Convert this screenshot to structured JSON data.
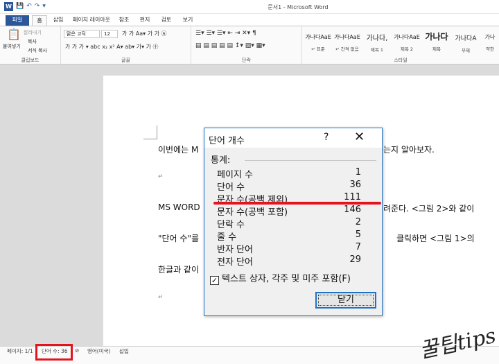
{
  "window": {
    "title": "문서1 - Microsoft Word"
  },
  "tabs": [
    "파일",
    "홈",
    "삽입",
    "페이지 레이아웃",
    "참조",
    "편지",
    "검토",
    "보기"
  ],
  "ribbon": {
    "clipboard": {
      "paste": "붙여넣기",
      "cut": "잘라내기",
      "copy": "복사",
      "format_painter": "서식 복사",
      "label": "클립보드"
    },
    "font": {
      "name": "맑은 고딕",
      "size": "12",
      "label": "글꼴"
    },
    "paragraph": {
      "label": "단락"
    },
    "styles": {
      "label": "스타일",
      "items": [
        {
          "sample": "가나다AaE",
          "name": "↵ 표준"
        },
        {
          "sample": "가나다AaE",
          "name": "↵ 간격 없음"
        },
        {
          "sample": "가나다,",
          "name": "제목 1"
        },
        {
          "sample": "가나다AaE",
          "name": "제목 2"
        },
        {
          "sample": "가나다",
          "name": "제목"
        },
        {
          "sample": "가나다A",
          "name": "부제"
        },
        {
          "sample": "가나",
          "name": "약한"
        }
      ]
    }
  },
  "document": {
    "line1_a": "이번에는 M",
    "line1_b": "는지 알아보자.",
    "line3_a": "MS WORD",
    "line3_b": "려준다. <그림 2>와 같이",
    "line4_a": "\"단어 수\"를",
    "line4_b": "클릭하면 <그림 1>의",
    "line5": "한글과 같이"
  },
  "dialog": {
    "title": "단어 개수",
    "help": "?",
    "close_x": "✕",
    "section": "통계:",
    "stats": [
      {
        "label": "페이지 수",
        "value": "1"
      },
      {
        "label": "단어 수",
        "value": "36"
      },
      {
        "label": "문자 수(공백 제외)",
        "value": "111"
      },
      {
        "label": "문자 수(공백 포함)",
        "value": "146"
      },
      {
        "label": "단락 수",
        "value": "2"
      },
      {
        "label": "줄 수",
        "value": "5"
      },
      {
        "label": "반자 단어",
        "value": "7"
      },
      {
        "label": "전자 단어",
        "value": "29"
      }
    ],
    "checkbox_label": "텍스트 상자, 각주 및 미주 포함(F)",
    "checkbox_checked": true,
    "close_button": "닫기"
  },
  "status": {
    "page": "페이지: 1/1",
    "words": "단어 수: 36",
    "language": "영어(미국)",
    "mode": "삽입"
  },
  "logo_text": "꿀팁tips",
  "colors": {
    "accent": "#2b579a",
    "highlight_red": "#e3141e",
    "dialog_border": "#1e73c9"
  }
}
